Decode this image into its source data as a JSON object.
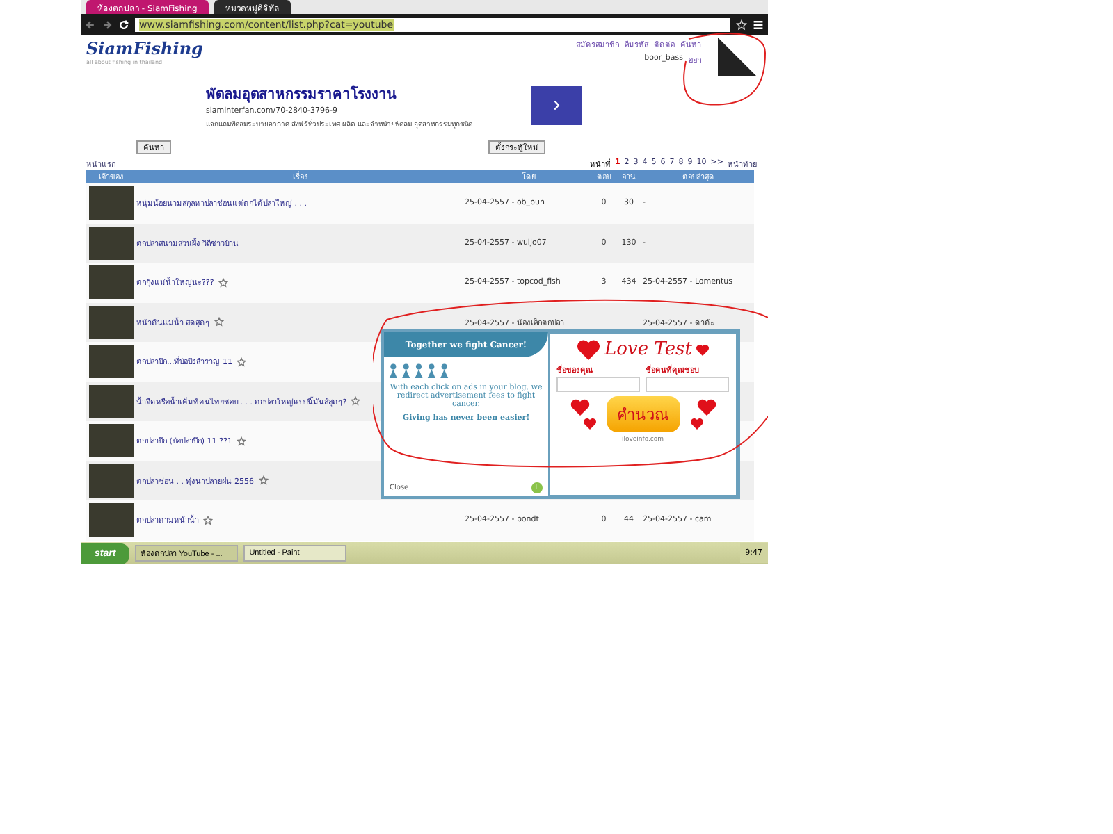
{
  "browser": {
    "tabs": [
      {
        "label": "ห้องตกปลา - SiamFishing",
        "selected": false
      },
      {
        "label": "หมวดหมู่ดิจิทัล",
        "selected": true
      }
    ],
    "url": "www.siamfishing.com/content/list.php?cat=youtube"
  },
  "header": {
    "logo": "SiamFishing",
    "tagline": "all about fishing in thailand",
    "links": [
      "สมัครสมาชิก",
      "ลืมรหัส",
      "ติดต่อ",
      "ค้นหา"
    ],
    "user": "boor_bass",
    "user_link": "ออก"
  },
  "ad": {
    "title": "พัดลมอุตสาหกรรมราคาโรงงาน",
    "url": "siaminterfan.com/70-2840-3796-9",
    "text": "แจกแถมพัดลมระบายอากาศ ส่งฟรีทั่วประเทศ ผลิต และจำหน่ายพัดลม อุตสาหกรรมทุกชนิด",
    "arrow": "›"
  },
  "actions": {
    "search_button": "ค้นหา",
    "new_topic_button": "ตั้งกระทู้ใหม่"
  },
  "home_link": "หน้าแรก",
  "pagination": {
    "label": "หน้าที่",
    "pages": [
      {
        "label": "1",
        "selected": true
      },
      {
        "label": "2",
        "selected": false
      },
      {
        "label": "3",
        "selected": false
      },
      {
        "label": "4",
        "selected": false
      },
      {
        "label": "5",
        "selected": false
      },
      {
        "label": "6",
        "selected": false
      },
      {
        "label": "7",
        "selected": false
      },
      {
        "label": "8",
        "selected": false
      },
      {
        "label": "9",
        "selected": false
      },
      {
        "label": "10",
        "selected": false
      }
    ],
    "next": ">>",
    "last": "หน้าท้าย"
  },
  "table": {
    "columns": [
      "เจ้าของ",
      "เรื่อง",
      "โดย",
      "ตอบ",
      "อ่าน",
      "ตอบล่าสุด"
    ],
    "rows": [
      {
        "title": "หนุ่มน้อยนามสกุลหาปลาช่อนแต่ตกได้ปลาใหญ่ . . .",
        "starred": false,
        "posted": "25-04-2557 - ob_pun",
        "replies": "0",
        "reads": "30",
        "last": "-"
      },
      {
        "title": "ตกปลาสนามสวนผึ้ง วิถีชาวบ้าน",
        "starred": false,
        "posted": "25-04-2557 - wuijo07",
        "replies": "0",
        "reads": "130",
        "last": "-"
      },
      {
        "title": "ตกกุ้งแม่น้ำใหญ่นะ???",
        "starred": true,
        "posted": "25-04-2557 - topcod_fish",
        "replies": "3",
        "reads": "434",
        "last": "25-04-2557 - Lomentus"
      },
      {
        "title": "หน้าดินแม่น้ำ สดสุดๆ",
        "starred": true,
        "posted": "25-04-2557 - น้องเล็กตกปลา",
        "replies": "",
        "reads": "",
        "last": "25-04-2557 - ดาต้ะ"
      },
      {
        "title": "ตกปลาบึก...ที่บ่อบึงสำราญ 11",
        "starred": true
      },
      {
        "title": "น้ำจืดหรือน้ำเค็มที่คนไทยชอบ . . . ตกปลาใหญ่แบบนี้มันส์สุดๆ?",
        "starred": true
      },
      {
        "title": "ตกปลาบึก (บ่อปลาบึก) 11 ??1",
        "starred": true
      },
      {
        "title": "ตกปลาช่อน . . ทุ่งนาปลายฝน 2556",
        "starred": true
      },
      {
        "title": "ตกปลาตามหน้าน้ำ",
        "starred": true,
        "posted": "25-04-2557 - pondt",
        "replies": "0",
        "reads": "44",
        "last": "25-04-2557 - cam"
      }
    ]
  },
  "popup": {
    "banner": "Together we fight Cancer!",
    "message": "With each click on ads in your blog, we redirect advertisement fees to fight cancer.",
    "slogan": "Giving has never been easier!",
    "close": "Close",
    "badge": "L",
    "game_title": "Love Test",
    "name_label": "ชื่อของคุณ",
    "crush_label": "ชื่อคนที่คุณชอบ",
    "button": "คำนวณ",
    "site": "iloveinfo.com"
  },
  "taskbar": {
    "start": "start",
    "windows": [
      {
        "label": "ห้องตกปลา YouTube - ...",
        "selected": true
      },
      {
        "label": "Untitled - Paint",
        "selected": false
      }
    ],
    "clock": "9:47"
  }
}
